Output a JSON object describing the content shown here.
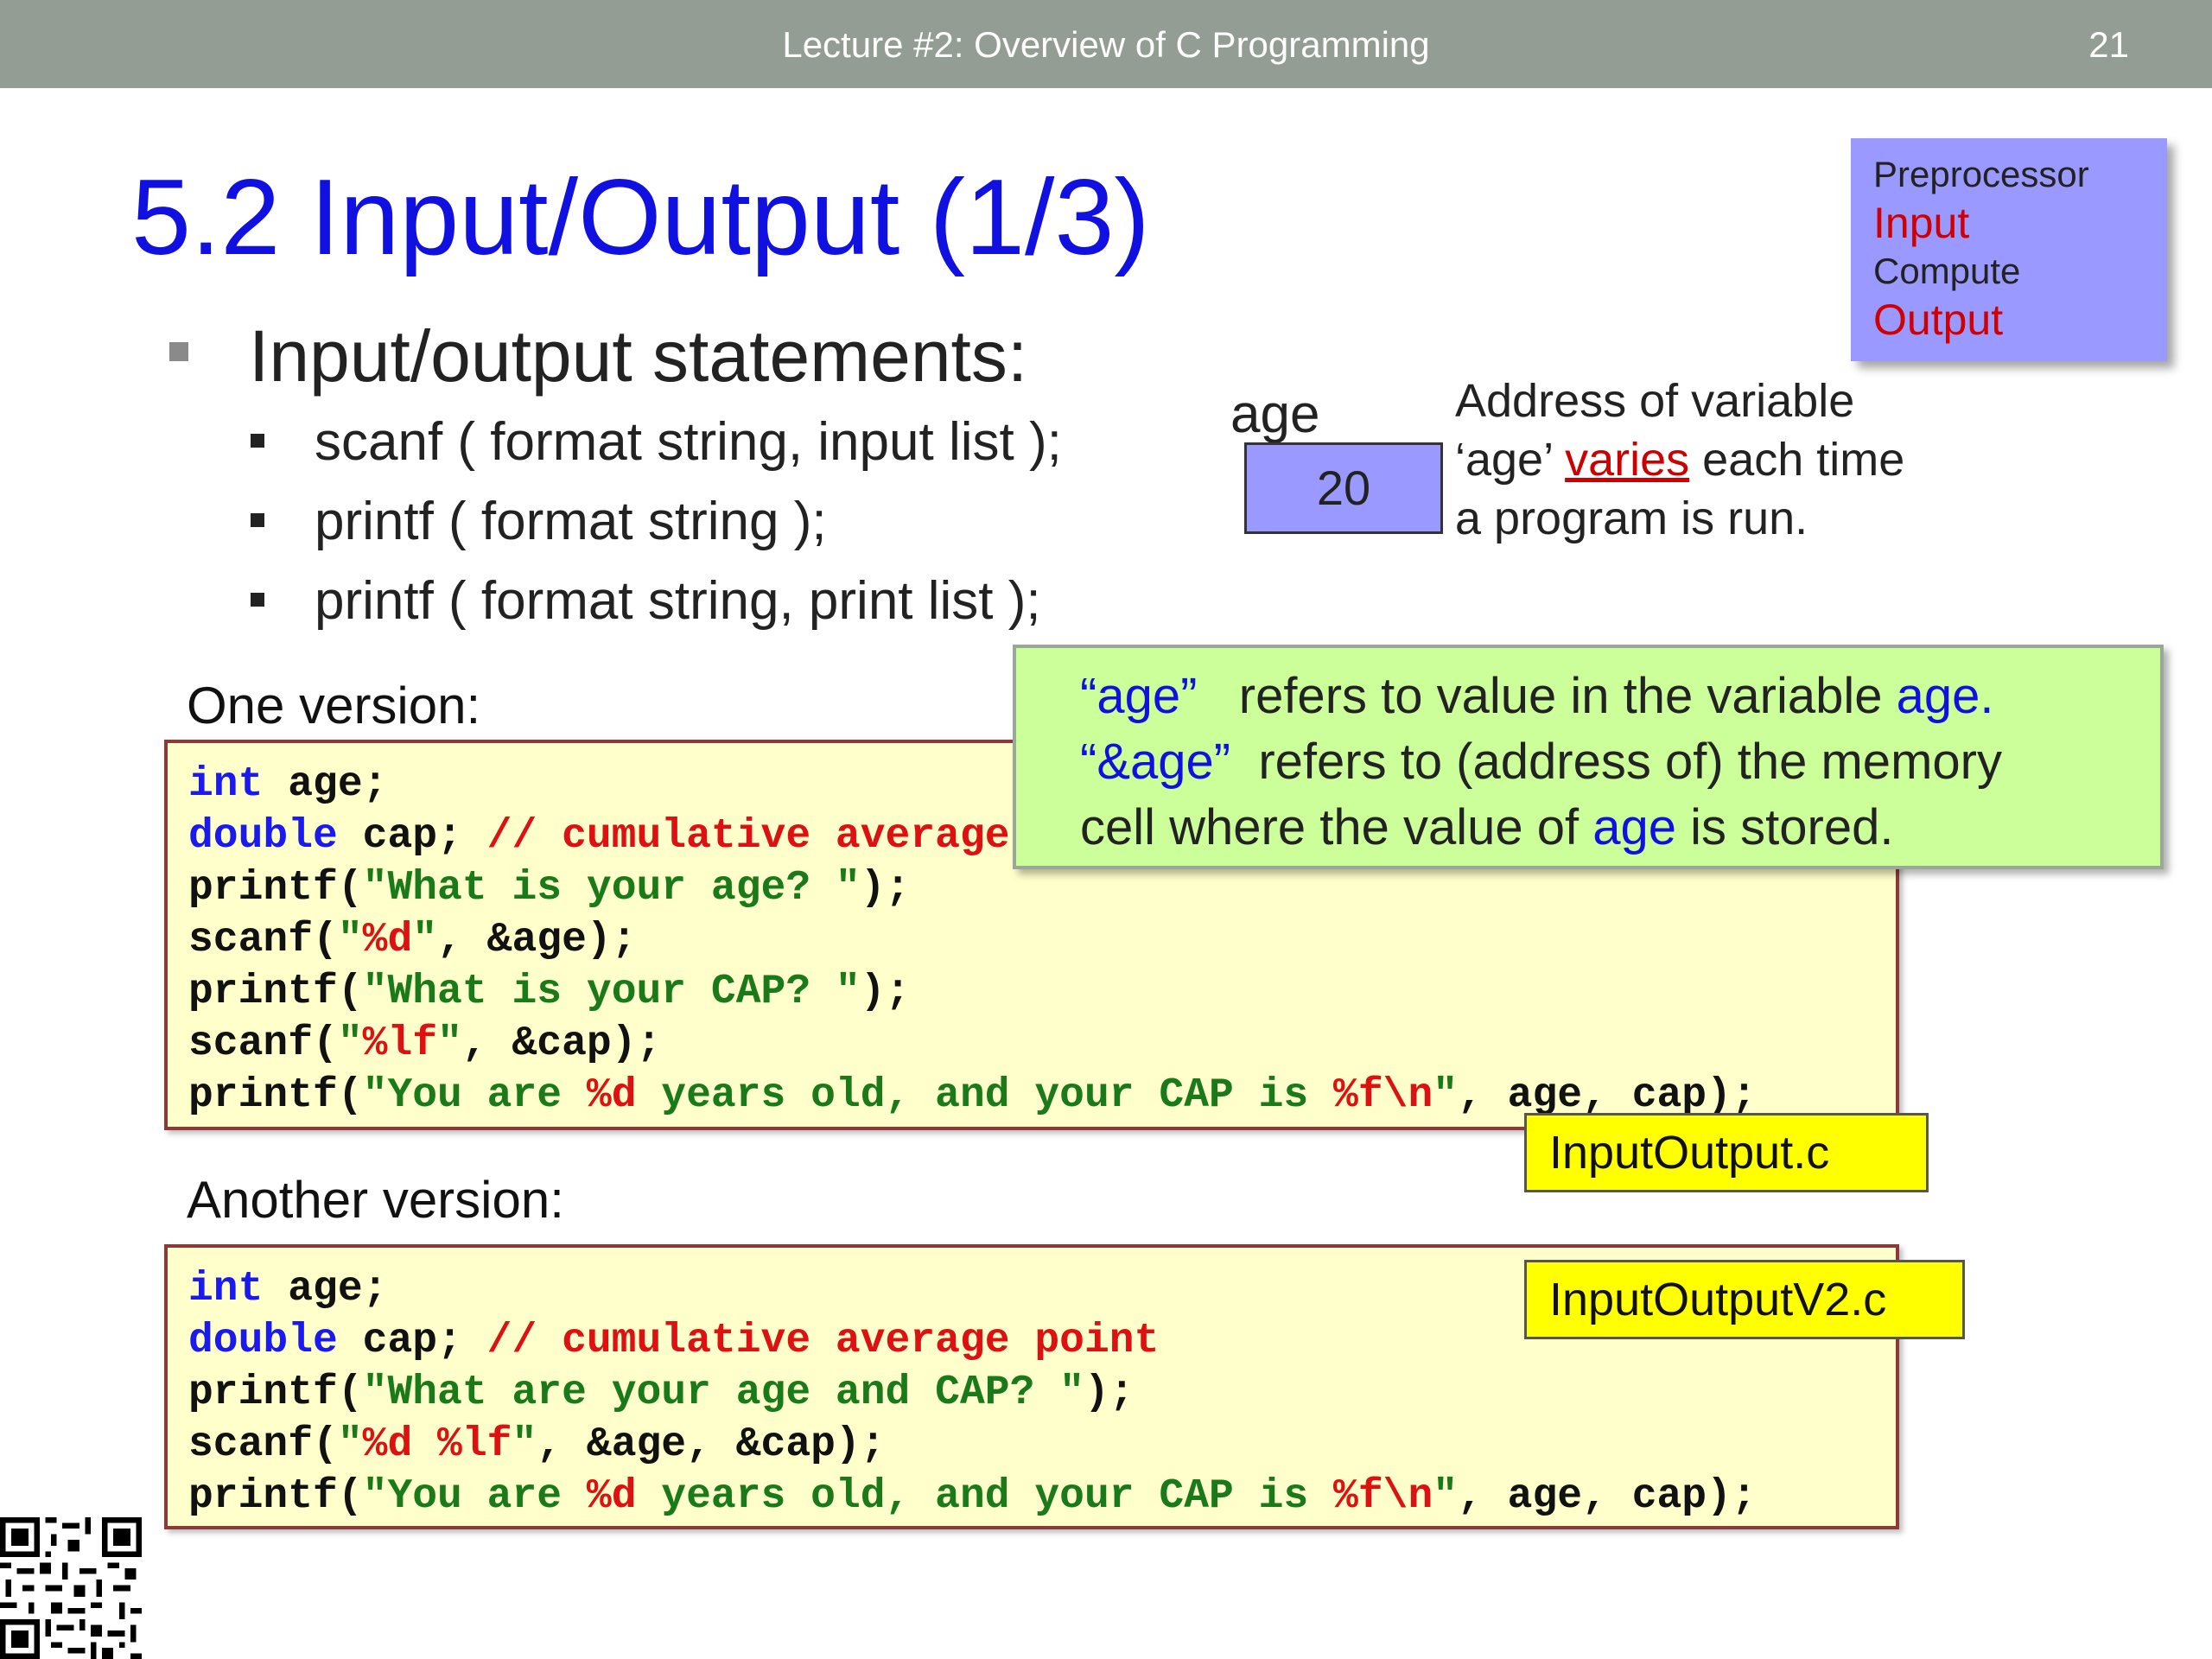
{
  "header": {
    "title": "Lecture #2: Overview of C Programming",
    "page_number": "21"
  },
  "slide_title": "5.2 Input/Output (1/3)",
  "stages": {
    "items": [
      {
        "label": "Preprocessor",
        "highlight": false
      },
      {
        "label": "Input",
        "highlight": true
      },
      {
        "label": "Compute",
        "highlight": false
      },
      {
        "label": "Output",
        "highlight": true
      }
    ]
  },
  "bullets": {
    "main": "Input/output statements:",
    "sub": [
      "scanf ( format string, input list );",
      "printf ( format string );",
      "printf ( format string, print list );"
    ]
  },
  "memory_diagram": {
    "var_name": "age",
    "value": "20",
    "note_part1": "Address of variable ‘age’",
    "note_highlight": "varies",
    "note_part2": "each time a program is run."
  },
  "explanation": {
    "line1_a": "“age”",
    "line1_b": "refers to value in the variable",
    "line1_c": "age.",
    "line2_a": "“&age”",
    "line2_b": "refers to (address of) the memory",
    "line3_a": "cell where the value of",
    "line3_b": "age",
    "line3_c": "is stored."
  },
  "version1": {
    "label": "One version:",
    "filename": "InputOutput.c",
    "code": {
      "l1_kw": "int",
      "l1_rest": " age;",
      "l2_kw": "double",
      "l2_rest": " cap; ",
      "l2_cmt": "// cumulative average point",
      "l3_fn": "printf(",
      "l3_str": "\"What is your age? \"",
      "l3_end": ");",
      "l4_fn": "scanf(",
      "l4_q1": "\"",
      "l4_fmt": "%d",
      "l4_q2": "\"",
      "l4_end": ", &age);",
      "l5_fn": "printf(",
      "l5_str": "\"What is your CAP? \"",
      "l5_end": ");",
      "l6_fn": "scanf(",
      "l6_q1": "\"",
      "l6_fmt": "%lf",
      "l6_q2": "\"",
      "l6_end": ", &cap);",
      "l7_fn": "printf(",
      "l7_s1": "\"You are ",
      "l7_f1": "%d",
      "l7_s2": " years old, and your CAP is ",
      "l7_f2": "%f\\n",
      "l7_s3": "\"",
      "l7_end": ", age, cap);"
    }
  },
  "version2": {
    "label": "Another version:",
    "filename": "InputOutputV2.c",
    "code": {
      "l1_kw": "int",
      "l1_rest": " age;",
      "l2_kw": "double",
      "l2_rest": " cap; ",
      "l2_cmt": "// cumulative average point",
      "l3_fn": "printf(",
      "l3_str": "\"What are your age and CAP? \"",
      "l3_end": ");",
      "l4_fn": "scanf(",
      "l4_q1": "\"",
      "l4_fmt": "%d %lf",
      "l4_q2": "\"",
      "l4_end": ", &age, &cap);",
      "l5_fn": "printf(",
      "l5_s1": "\"You are ",
      "l5_f1": "%d",
      "l5_s2": " years old, and your CAP is ",
      "l5_f2": "%f\\n",
      "l5_s3": "\"",
      "l5_end": ", age, cap);"
    }
  },
  "colors": {
    "title_blue": "#1010e0",
    "highlight_red": "#d00000",
    "keyword_blue": "#1a1aee",
    "string_green": "#1a7a1a",
    "format_red": "#dd1111",
    "code_bg": "#ffffcc",
    "note_bg": "#ccff99",
    "stage_bg": "#9999ff",
    "file_label_bg": "#ffff00",
    "header_bg": "#949d94"
  },
  "icons": {
    "qr": "qr-code-icon"
  }
}
